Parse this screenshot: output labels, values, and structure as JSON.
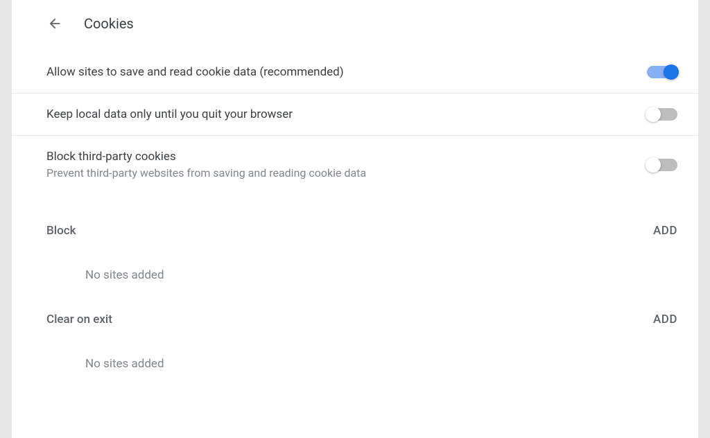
{
  "header": {
    "title": "Cookies"
  },
  "settings": {
    "allowCookies": {
      "label": "Allow sites to save and read cookie data (recommended)",
      "enabled": true
    },
    "keepLocalData": {
      "label": "Keep local data only until you quit your browser",
      "enabled": false
    },
    "blockThirdParty": {
      "label": "Block third-party cookies",
      "desc": "Prevent third-party websites from saving and reading cookie data",
      "enabled": false
    }
  },
  "sections": {
    "block": {
      "title": "Block",
      "addLabel": "ADD",
      "emptyText": "No sites added"
    },
    "clearOnExit": {
      "title": "Clear on exit",
      "addLabel": "ADD",
      "emptyText": "No sites added"
    }
  }
}
